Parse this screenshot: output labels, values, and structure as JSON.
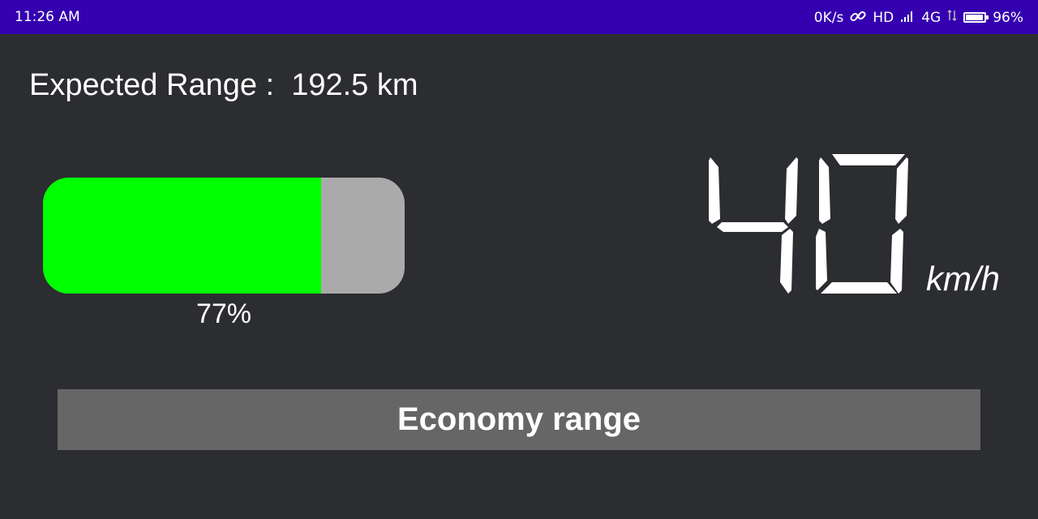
{
  "status_bar": {
    "time": "11:26 AM",
    "network_speed": "0K/s",
    "hd_label": "HD",
    "network_type": "4G",
    "battery_percent": "96%",
    "battery_level": 0.96,
    "icons": [
      "link-icon",
      "signal-icon",
      "data-arrows-icon",
      "battery-icon"
    ]
  },
  "range": {
    "label": "Expected Range :",
    "value": "192.5 km"
  },
  "battery": {
    "percent_label": "77%",
    "level": 0.77,
    "fill_color": "#00ff00",
    "empty_color": "#aaaaaa"
  },
  "speed": {
    "value": "40",
    "unit": "km/h"
  },
  "mode": {
    "label": "Economy range"
  },
  "colors": {
    "status_bar": "#3500b0",
    "background": "#2c2d30",
    "banner": "#666666",
    "text": "#ffffff"
  }
}
